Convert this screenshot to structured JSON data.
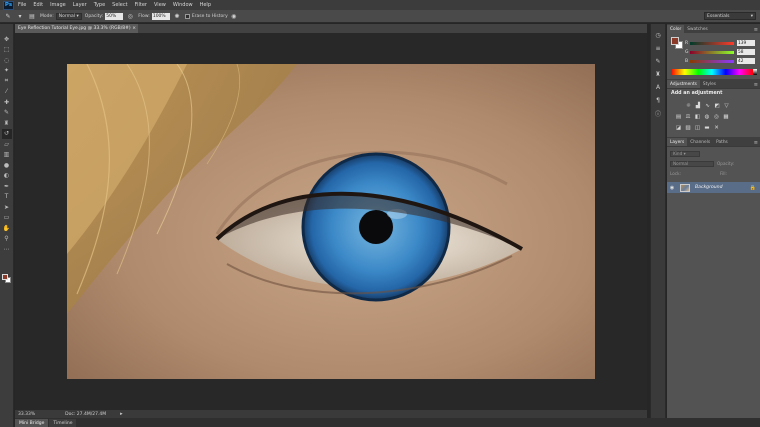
{
  "app": {
    "logo": "Ps"
  },
  "menu": [
    "File",
    "Edit",
    "Image",
    "Layer",
    "Type",
    "Select",
    "Filter",
    "View",
    "Window",
    "Help"
  ],
  "options": {
    "tool_icon": "brush-icon",
    "mode_label": "Mode:",
    "mode_value": "Normal",
    "opacity_label": "Opacity:",
    "opacity_value": "50%",
    "flow_label": "Flow:",
    "flow_value": "100%",
    "smoothing_label": "Erase to History",
    "workspace": "Essentials"
  },
  "document": {
    "tab_title": "Eye Reflection Tutorial Eye.jpg @ 33.3% (RGB/8#)",
    "zoom": "33.33%",
    "doc_info": "Doc: 27.4M/27.4M"
  },
  "bottom_tabs": [
    "Mini Bridge",
    "Timeline"
  ],
  "color_panel": {
    "tabs": [
      "Color",
      "Swatches"
    ],
    "fg_color": "#8b3a2a",
    "bg_color": "#ffffff",
    "r_label": "R",
    "r_value": "139",
    "g_label": "G",
    "g_value": "58",
    "b_label": "B",
    "b_value": "42"
  },
  "adjustments": {
    "tabs": [
      "Adjustments",
      "Styles"
    ],
    "title": "Add an adjustment"
  },
  "layers": {
    "tabs": [
      "Layers",
      "Channels",
      "Paths"
    ],
    "filter_label": "Kind",
    "blend_mode": "Normal",
    "opacity_label": "Opacity:",
    "lock_label": "Lock:",
    "fill_label": "Fill:",
    "layer_name": "Background"
  }
}
